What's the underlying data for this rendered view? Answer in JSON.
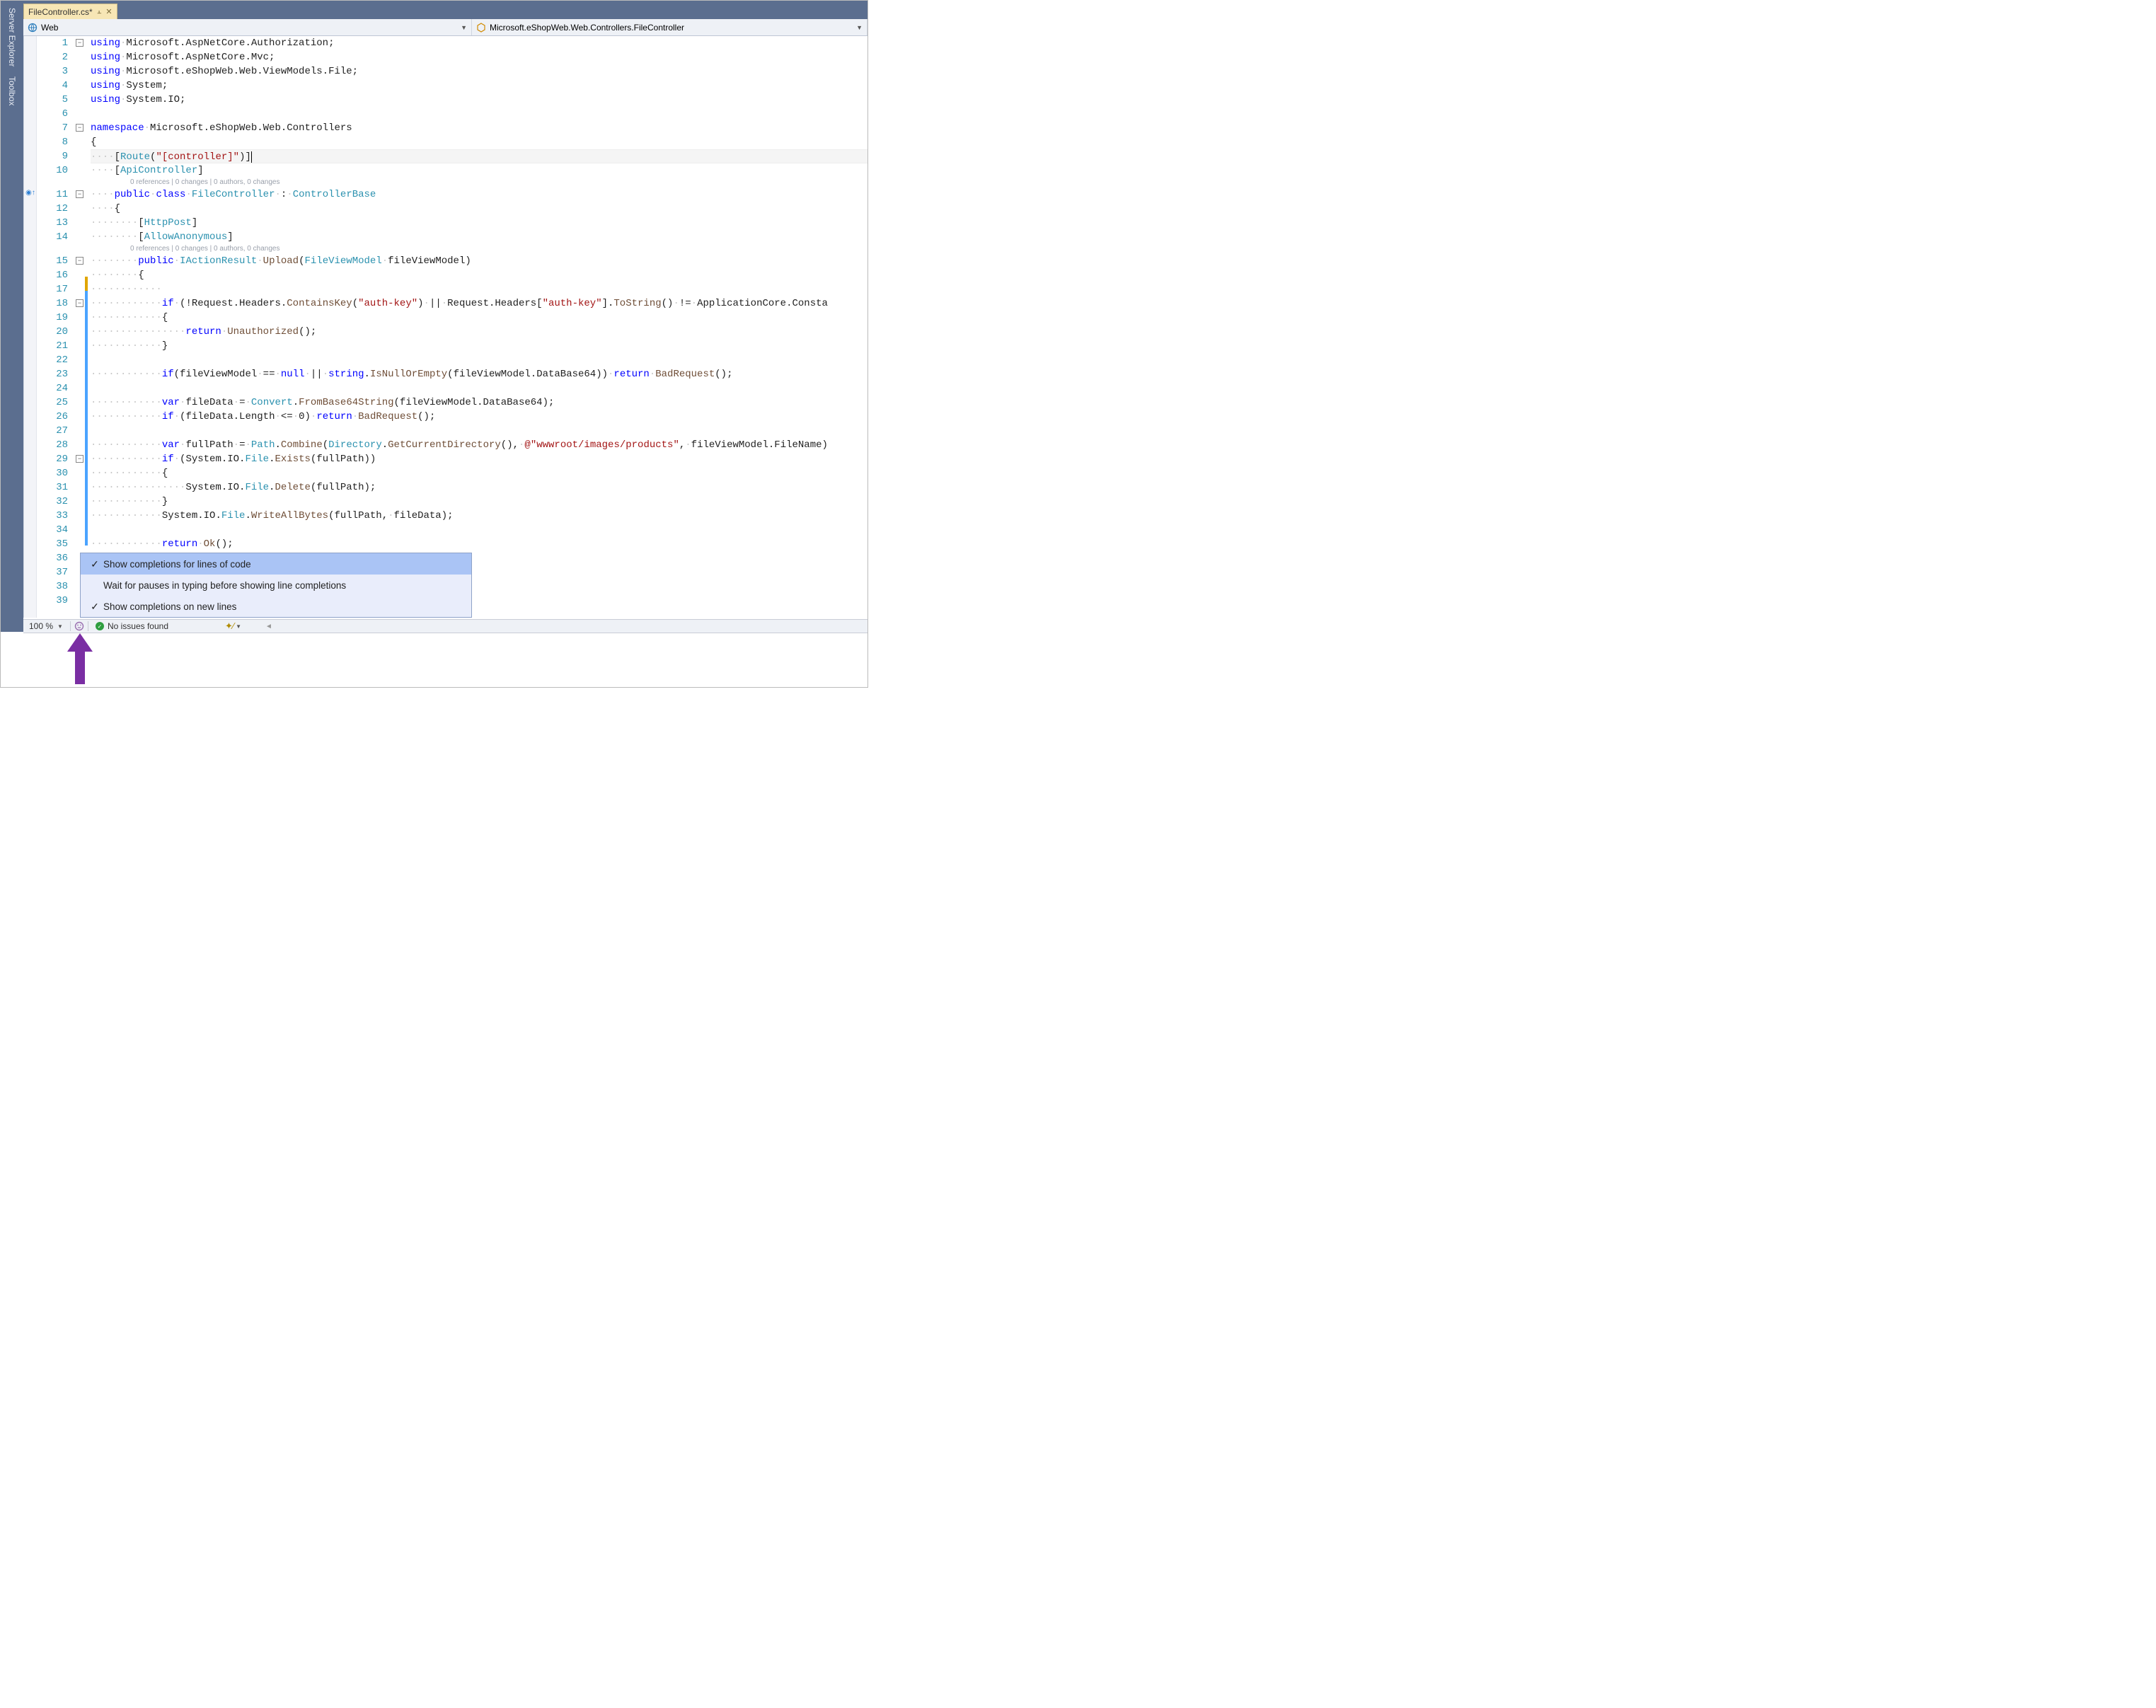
{
  "side_panels": [
    "Server Explorer",
    "Toolbox"
  ],
  "tab": {
    "label": "FileController.cs*"
  },
  "nav": {
    "scope": "Web",
    "member": "Microsoft.eShopWeb.Web.Controllers.FileController"
  },
  "codelens": "0 references | 0 changes | 0 authors, 0 changes",
  "code": {
    "l1": "using Microsoft.AspNetCore.Authorization;",
    "l2": "using Microsoft.AspNetCore.Mvc;",
    "l3": "using Microsoft.eShopWeb.Web.ViewModels.File;",
    "l4": "using System;",
    "l5": "using System.IO;",
    "l6": "",
    "l7": "namespace Microsoft.eShopWeb.Web.Controllers",
    "l8": "{",
    "l9": "    [Route(\"[controller]\")]",
    "l10": "    [ApiController]",
    "l11": "    public class FileController : ControllerBase",
    "l12": "    {",
    "l13": "        [HttpPost]",
    "l14": "        [AllowAnonymous]",
    "l15": "        public IActionResult Upload(FileViewModel fileViewModel)",
    "l16": "        {",
    "l17": "            ",
    "l18": "            if (!Request.Headers.ContainsKey(\"auth-key\") || Request.Headers[\"auth-key\"].ToString() != ApplicationCore.Consta",
    "l19": "            {",
    "l20": "                return Unauthorized();",
    "l21": "            }",
    "l22": "",
    "l23": "            if(fileViewModel == null || string.IsNullOrEmpty(fileViewModel.DataBase64)) return BadRequest();",
    "l24": "",
    "l25": "            var fileData = Convert.FromBase64String(fileViewModel.DataBase64);",
    "l26": "            if (fileData.Length <= 0) return BadRequest();",
    "l27": "",
    "l28": "            var fullPath = Path.Combine(Directory.GetCurrentDirectory(), @\"wwwroot/images/products\", fileViewModel.FileName)",
    "l29": "            if (System.IO.File.Exists(fullPath))",
    "l30": "            {",
    "l31": "                System.IO.File.Delete(fullPath);",
    "l32": "            }",
    "l33": "            System.IO.File.WriteAllBytes(fullPath, fileData);",
    "l34": "",
    "l35": "            return Ok();",
    "l36": "",
    "l37": "",
    "l38": "",
    "l39": ""
  },
  "popup": {
    "items": [
      {
        "checked": true,
        "label": "Show completions for lines of code"
      },
      {
        "checked": false,
        "label": "Wait for pauses in typing before showing line completions"
      },
      {
        "checked": true,
        "label": "Show completions on new lines"
      }
    ]
  },
  "status": {
    "zoom": "100 %",
    "issues": "No issues found"
  },
  "colors": {
    "chrome": "#5b6e8f",
    "tab_active": "#f7e6b5",
    "popup_bg": "#e9edfb",
    "popup_sel": "#aac4f5",
    "arrow": "#7a2ea3"
  }
}
